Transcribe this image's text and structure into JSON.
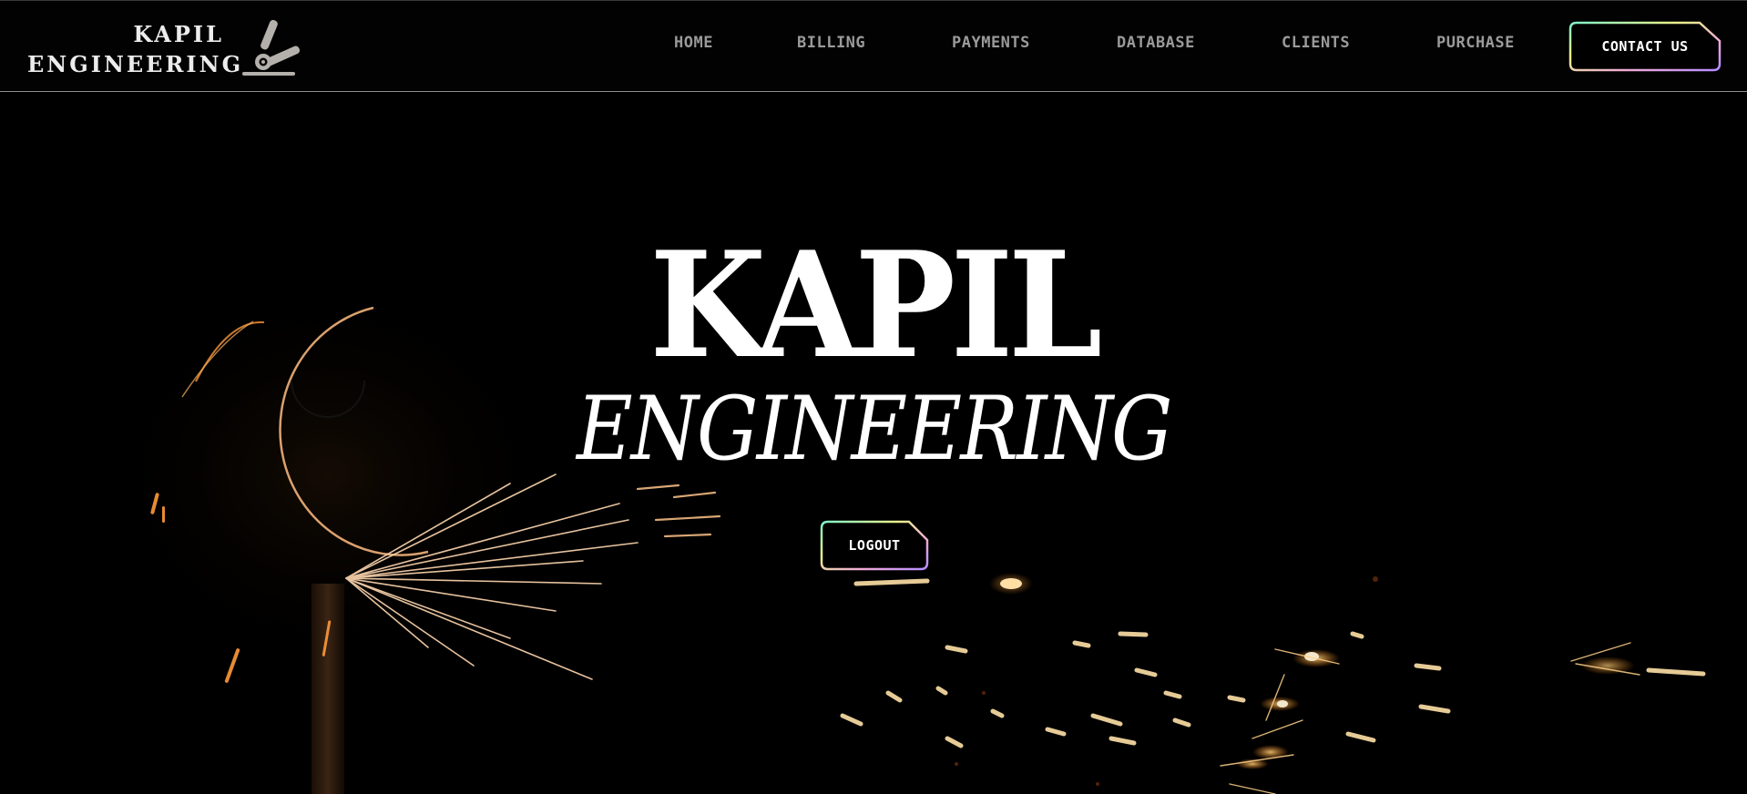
{
  "brand": {
    "line1": "KAPIL",
    "line2": "ENGINEERING",
    "logo_icon": "angle-grinder-icon"
  },
  "nav": {
    "items": [
      {
        "label": "HOME"
      },
      {
        "label": "BILLING"
      },
      {
        "label": "PAYMENTS"
      },
      {
        "label": "DATABASE"
      },
      {
        "label": "CLIENTS"
      },
      {
        "label": "PURCHASE"
      }
    ],
    "contact_label": "CONTACT US"
  },
  "hero": {
    "title": "KAPIL",
    "subtitle": "ENGINEERING",
    "logout_label": "LOGOUT",
    "background": "grinding-sparks-photo"
  },
  "colors": {
    "background": "#000000",
    "nav_text": "#9a9a9a",
    "text": "#ffffff",
    "button_gradient": [
      "#7ef0c8",
      "#e9f08a",
      "#f0a8d8",
      "#b48cff"
    ],
    "spark": "#ffb347"
  }
}
